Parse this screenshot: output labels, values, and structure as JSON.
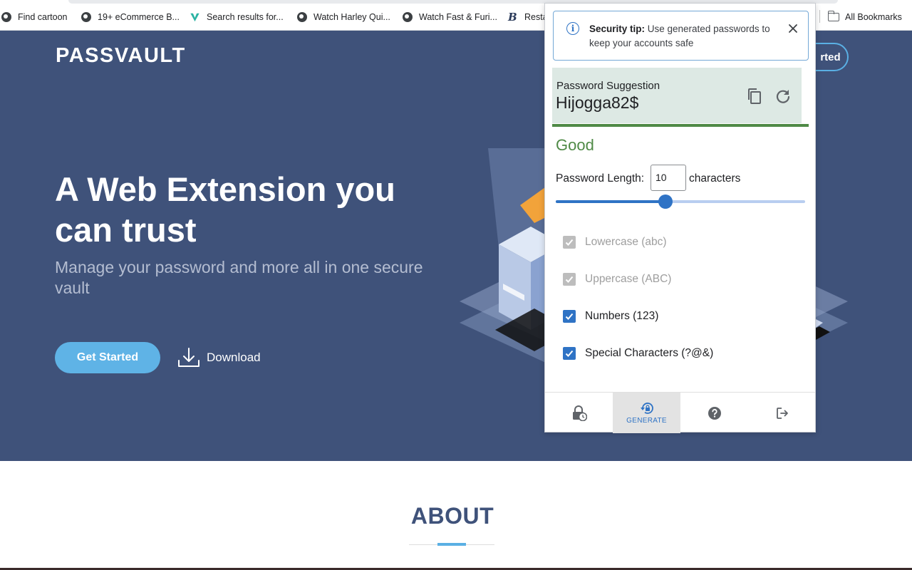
{
  "bookmarks": {
    "items": [
      {
        "label": "Find cartoon",
        "icon": "globe-icon"
      },
      {
        "label": "19+ eCommerce B...",
        "icon": "globe-icon"
      },
      {
        "label": "Search results for...",
        "icon": "v-logo-icon"
      },
      {
        "label": "Watch Harley Qui...",
        "icon": "globe-icon"
      },
      {
        "label": "Watch Fast & Furi...",
        "icon": "globe-icon"
      },
      {
        "label": "Resta",
        "icon": "b-logo-icon"
      }
    ],
    "all_label": "All Bookmarks"
  },
  "site": {
    "brand": "PASSVAULT",
    "nav_button_partial": "rted",
    "headline": "A Web Extension you can trust",
    "subhead": "Manage your password and more all in one secure vault",
    "cta_primary": "Get Started",
    "cta_secondary": "Download",
    "about_title": "ABOUT",
    "colors": {
      "hero_bg": "#3f527a",
      "accent": "#5fb3e6"
    }
  },
  "popup": {
    "tip": {
      "bold": "Security tip:",
      "text": " Use generated passwords to keep your accounts safe"
    },
    "suggestion": {
      "label": "Password Suggestion",
      "value": "Hijogga82$"
    },
    "strength": {
      "label": "Good",
      "color": "#4f8a46"
    },
    "length": {
      "label": "Password Length:",
      "value": "10",
      "unit": "characters",
      "slider_fraction": 0.44
    },
    "options": [
      {
        "label": "Lowercase (abc)",
        "checked": true,
        "disabled": true
      },
      {
        "label": "Uppercase (ABC)",
        "checked": true,
        "disabled": true
      },
      {
        "label": "Numbers (123)",
        "checked": true,
        "disabled": false
      },
      {
        "label": "Special Characters (?@&)",
        "checked": true,
        "disabled": false
      }
    ],
    "nav": [
      {
        "name": "vault",
        "label": "",
        "icon": "lock-clock-icon",
        "selected": false
      },
      {
        "name": "generate",
        "label": "GENERATE",
        "icon": "lock-reset-icon",
        "selected": true
      },
      {
        "name": "help",
        "label": "",
        "icon": "help-icon",
        "selected": false
      },
      {
        "name": "logout",
        "label": "",
        "icon": "logout-icon",
        "selected": false
      }
    ],
    "accent_color": "#2f73c5"
  }
}
